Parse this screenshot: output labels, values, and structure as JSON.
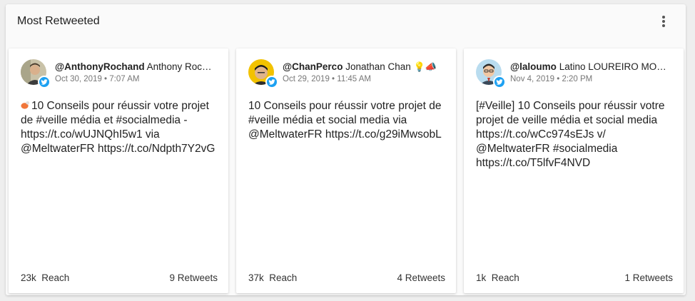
{
  "panel": {
    "title": "Most Retweeted"
  },
  "cards": [
    {
      "handle": "@AnthonyRochand",
      "name": "Anthony Rochand",
      "emoji": "",
      "date": "Oct 30, 2019",
      "time": "7:07 AM",
      "text_icon": "megaphone-icon",
      "text": "10 Conseils pour réussir votre projet de #veille média et #socialmedia - https://t.co/wUJNQhI5w1 via @MeltwaterFR https://t.co/Ndpth7Y2vG",
      "reach": "23k",
      "reach_label": "Reach",
      "retweets": "9 Retweets"
    },
    {
      "handle": "@ChanPerco",
      "name": "Jonathan Chan",
      "emoji": "💡📣",
      "date": "Oct 29, 2019",
      "time": "11:45 AM",
      "text": "10 Conseils pour réussir votre projet de #veille média et social media via @MeltwaterFR https://t.co/g29iMwsobL",
      "reach": "37k",
      "reach_label": "Reach",
      "retweets": "4 Retweets"
    },
    {
      "handle": "@laloumo",
      "name": "Latino LOUREIRO MOREIRA",
      "emoji": "",
      "date": "Nov 4, 2019",
      "time": "2:20 PM",
      "text": "[#Veille] 10 Conseils pour réussir votre projet de veille média et social media https://t.co/wCc974sEJs v/ @MeltwaterFR #socialmedia https://t.co/T5lfvF4NVD",
      "reach": "1k",
      "reach_label": "Reach",
      "retweets": "1 Retweets"
    }
  ],
  "colors": {
    "twitter_blue": "#1da1f2",
    "card_bg": "#ffffff",
    "panel_bg": "#fafafa"
  }
}
